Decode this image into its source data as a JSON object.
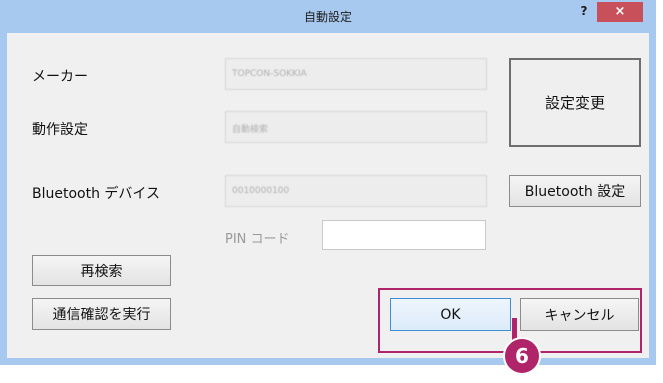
{
  "window": {
    "title": "自動設定",
    "help_label": "?",
    "close_label": "×"
  },
  "form": {
    "maker_label": "メーカー",
    "maker_value": "TOPCON-SOKKIA",
    "operation_label": "動作設定",
    "operation_value": "自動検索",
    "bluetooth_device_label": "Bluetooth デバイス",
    "bluetooth_device_value": "0010000100",
    "pin_label": "PIN コード",
    "pin_value": ""
  },
  "buttons": {
    "change_settings": "設定変更",
    "bluetooth_settings": "Bluetooth 設定",
    "research": "再検索",
    "run_comm_check": "通信確認を実行",
    "ok": "OK",
    "cancel": "キャンセル"
  },
  "annotation": {
    "step_number": "6"
  }
}
